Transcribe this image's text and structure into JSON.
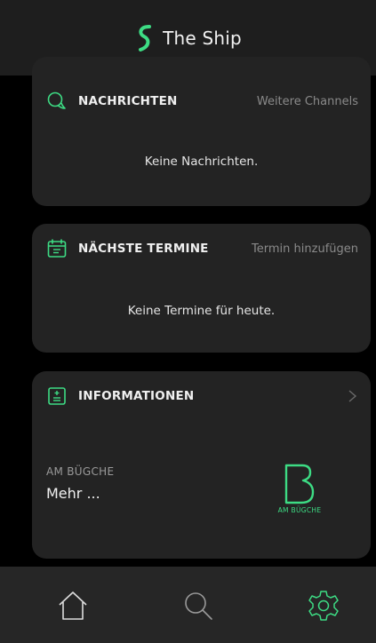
{
  "header": {
    "app_title": "The Ship",
    "logo_icon": "ship-s-logo-icon"
  },
  "messages_card": {
    "title": "NACHRICHTEN",
    "action_label": "Weitere Channels",
    "empty_text": "Keine Nachrichten.",
    "icon": "chat-bubble-icon"
  },
  "appointments_card": {
    "title": "NÄCHSTE TERMINE",
    "action_label": "Termin hinzufügen",
    "empty_text": "Keine Termine für heute.",
    "icon": "calendar-icon"
  },
  "info_card": {
    "title": "INFORMATIONEN",
    "icon": "info-list-icon",
    "item_label": "AM BÜGCHE",
    "item_link": "Mehr ...",
    "brand_caption": "AM BÜGCHE"
  },
  "bottom_nav": {
    "items": [
      "home-icon",
      "search-icon",
      "settings-gear-icon"
    ]
  },
  "colors": {
    "accent": "#3ddc84",
    "background": "#000000",
    "card": "#232323",
    "header": "#1e1e1e",
    "nav": "#262626"
  }
}
